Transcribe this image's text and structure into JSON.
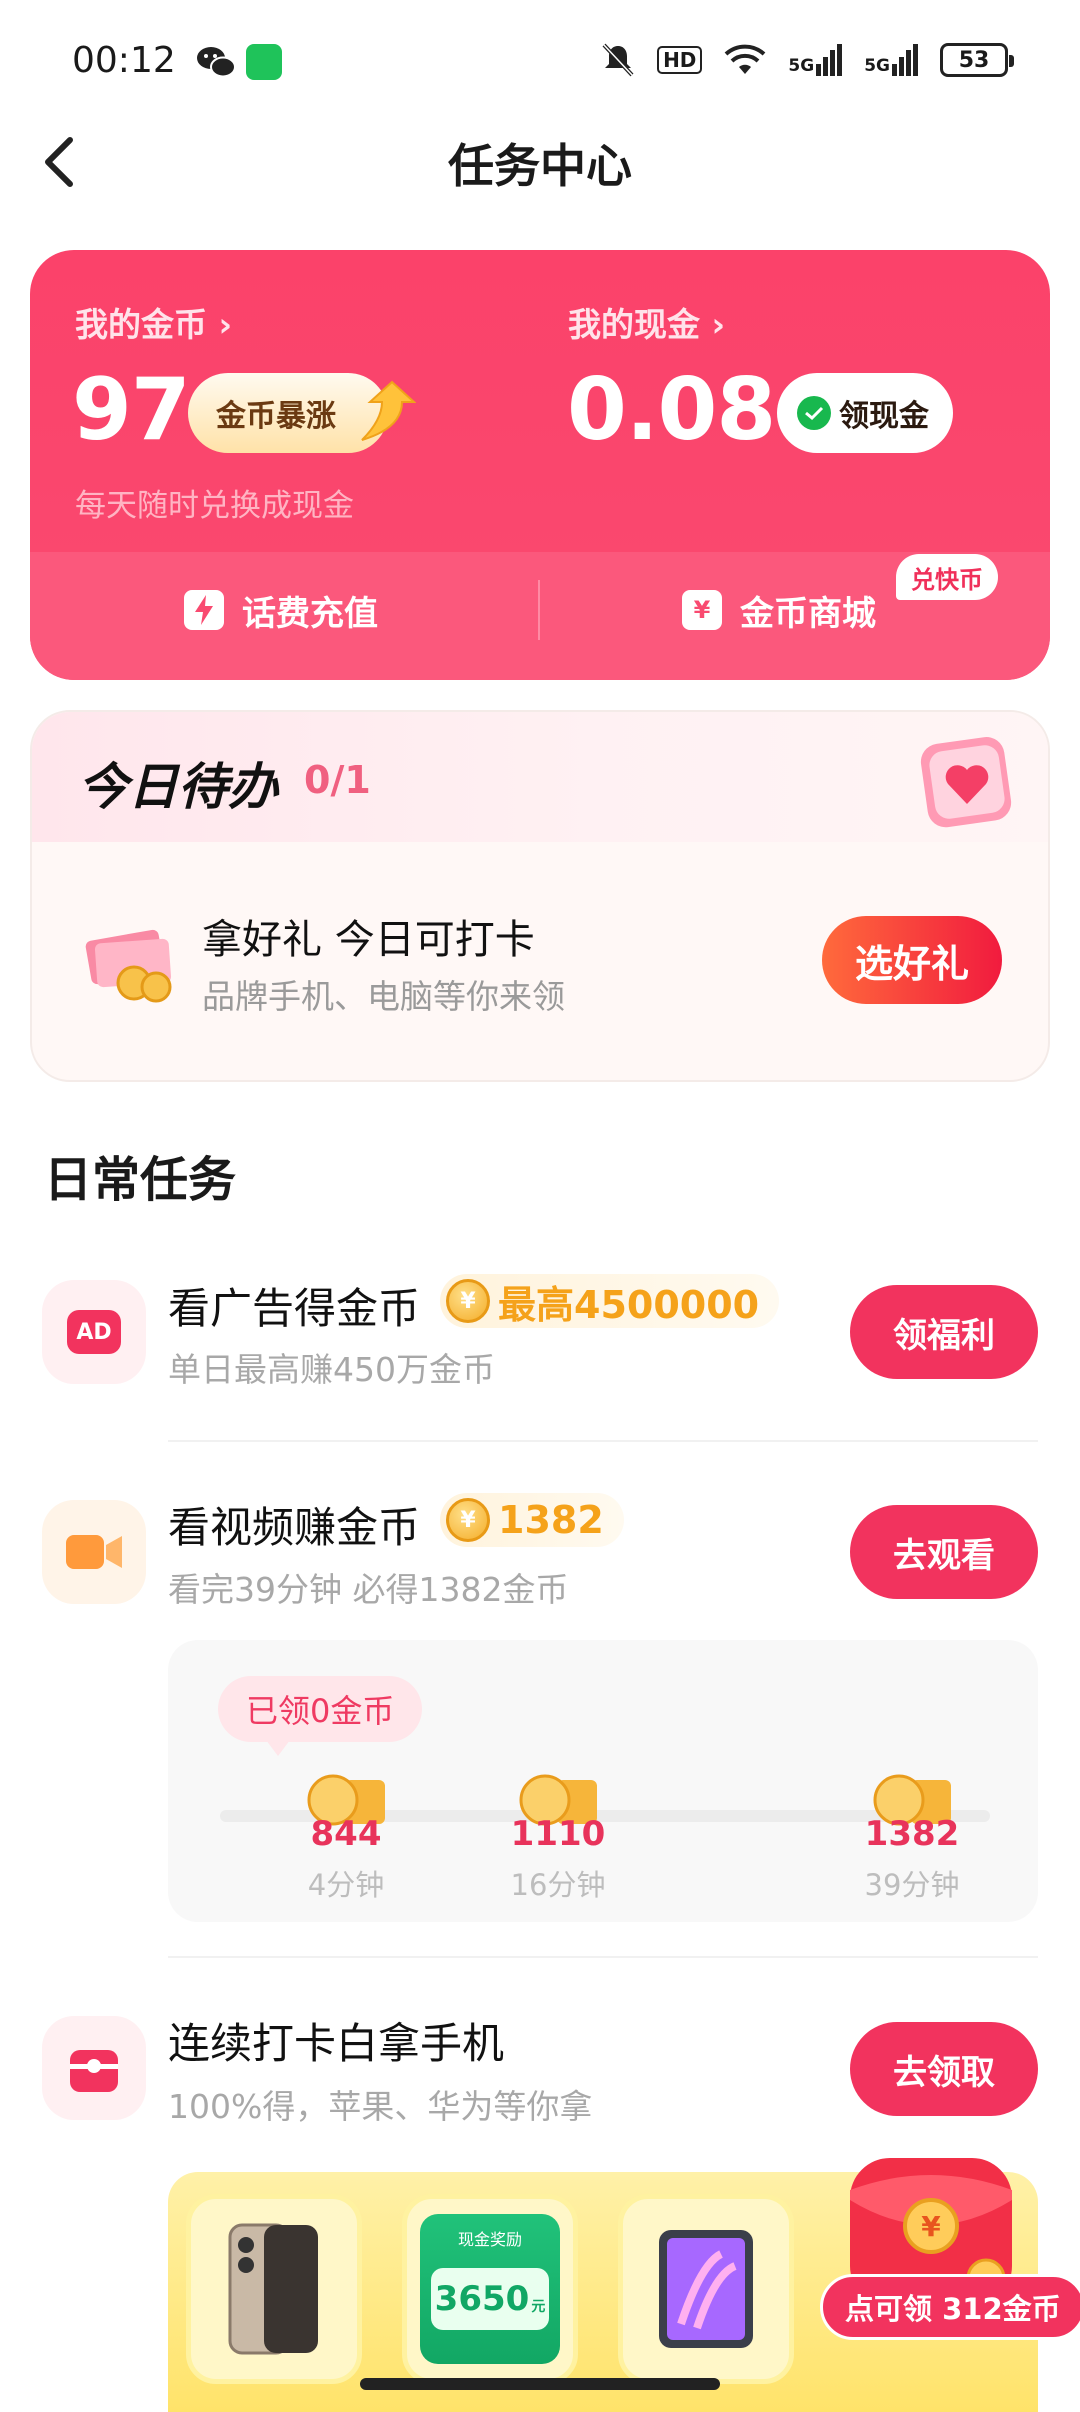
{
  "status_bar": {
    "time": "00:12",
    "battery": "53",
    "hd_label": "HD",
    "net1": "5G",
    "net2": "5G"
  },
  "header": {
    "title": "任务中心"
  },
  "wallet": {
    "coins_label": "我的金币",
    "coins_value": "97",
    "boom_label": "金币暴涨",
    "hint": "每天随时兑换成现金",
    "cash_label": "我的现金",
    "cash_value": "0.08",
    "withdraw_label": "领现金",
    "recharge_label": "话费充值",
    "mall_label": "金币商城",
    "mall_badge": "兑快币"
  },
  "todo": {
    "title": "今日待办",
    "count": "0/1",
    "item_title": "拿好礼 今日可打卡",
    "item_sub": "品牌手机、电脑等你来领",
    "button": "选好礼"
  },
  "daily": {
    "title": "日常任务",
    "tasks": [
      {
        "title": "看广告得金币",
        "reward": "最高4500000",
        "sub": "单日最高赚450万金币",
        "button": "领福利"
      },
      {
        "title": "看视频赚金币",
        "reward": "1382",
        "sub": "看完39分钟 必得1382金币",
        "button": "去观看"
      },
      {
        "title": "连续打卡白拿手机",
        "sub": "100%得，苹果、华为等你拿",
        "button": "去领取"
      }
    ],
    "progress": {
      "claimed": "已领0金币",
      "milestones": [
        {
          "value": "844",
          "time": "4分钟"
        },
        {
          "value": "1110",
          "time": "16分钟"
        },
        {
          "value": "1382",
          "time": "39分钟"
        }
      ]
    },
    "prizes": {
      "cash_title": "现金奖励",
      "cash_amount": "3650",
      "cash_unit": "元"
    }
  },
  "float_reward": "点可领 312金币",
  "colors": {
    "brand": "#f2335e",
    "coin": "#f5a21a"
  }
}
